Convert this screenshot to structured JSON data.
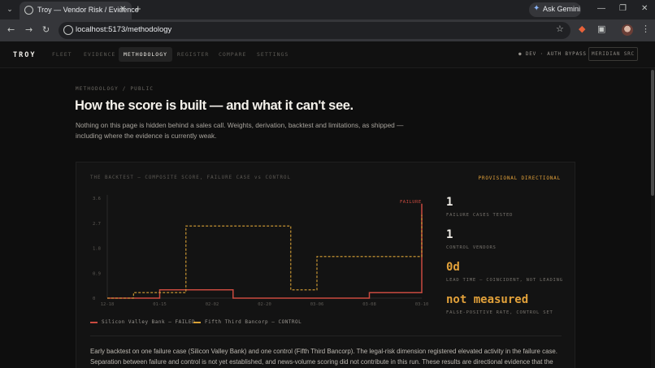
{
  "browser": {
    "tab_title": "Troy — Vendor Risk / Evidence",
    "tab_close": "✕",
    "new_tab": "+",
    "gemini_label": "Ask Gemini",
    "url": "localhost:5173/methodology",
    "window_minimize": "—",
    "window_restore": "❐",
    "window_close": "✕"
  },
  "app": {
    "brand": "TROY",
    "nav": [
      "FLEET",
      "EVIDENCE",
      "METHODOLOGY",
      "REGISTER",
      "COMPARE",
      "SETTINGS"
    ],
    "active_nav": "METHODOLOGY",
    "dev_flag": "● DEV · AUTH BYPASS",
    "source_button": "MERIDIAN SRC"
  },
  "page": {
    "breadcrumb": "METHODOLOGY / PUBLIC",
    "title": "How the score is built — and what it can't see.",
    "lede": "Nothing on this page is hidden behind a sales call. Weights, derivation, backtest and limitations, as shipped — including where the evidence is currently weak."
  },
  "backtest": {
    "title": "THE BACKTEST — COMPOSITE SCORE, FAILURE CASE vs CONTROL",
    "badge": "PROVISIONAL DIRECTIONAL",
    "failure_marker": "FAILURE",
    "legend": {
      "failed": "Silicon Valley Bank — FAILED",
      "control": "Fifth Third Bancorp — CONTROL"
    },
    "stats": [
      {
        "value": "1",
        "label": "FAILURE CASES TESTED",
        "accent": false
      },
      {
        "value": "1",
        "label": "CONTROL VENDORS",
        "accent": false
      },
      {
        "value": "0d",
        "label": "LEAD TIME — COINCIDENT, NOT LEADING",
        "accent": true
      },
      {
        "value": "not measured",
        "label": "FALSE-POSITIVE RATE, CONTROL SET",
        "accent": true
      }
    ],
    "body": "Early backtest on one failure case (Silicon Valley Bank) and one control (Fifth Third Bancorp). The legal-risk dimension registered elevated activity in the failure case. Separation between failure and control is not yet established, and news-volume scoring did not contribute in this run. These results are directional evidence that the"
  },
  "colors": {
    "failed": "#c94a3f",
    "control": "#d9a236",
    "accent": "#e2a13a"
  },
  "chart_data": {
    "type": "line",
    "step": true,
    "x_tick_labels": [
      "12-18",
      "01-15",
      "02-02",
      "02-20",
      "03-06",
      "03-08",
      "03-10"
    ],
    "y_tick_labels": [
      "0",
      "0.9",
      "1.8",
      "2.7",
      "3.6"
    ],
    "ylim": [
      0,
      3.6
    ],
    "grid": false,
    "legend_position": "bottom-left",
    "series": [
      {
        "name": "Silicon Valley Bank — FAILED",
        "style": "solid",
        "points": [
          [
            0,
            0
          ],
          [
            1.0,
            0
          ],
          [
            1.0,
            0.3
          ],
          [
            2.4,
            0.3
          ],
          [
            2.4,
            0
          ],
          [
            5.0,
            0
          ],
          [
            5.0,
            0.2
          ],
          [
            6.0,
            0.2
          ],
          [
            6.0,
            3.4
          ]
        ]
      },
      {
        "name": "Fifth Third Bancorp — CONTROL",
        "style": "dashed",
        "points": [
          [
            0,
            0
          ],
          [
            0.5,
            0
          ],
          [
            0.5,
            0.2
          ],
          [
            1.5,
            0.2
          ],
          [
            1.5,
            2.6
          ],
          [
            3.5,
            2.6
          ],
          [
            3.5,
            0.3
          ],
          [
            4.0,
            0.3
          ],
          [
            4.0,
            1.5
          ],
          [
            6.0,
            1.5
          ],
          [
            6.0,
            3.0
          ]
        ]
      }
    ]
  }
}
